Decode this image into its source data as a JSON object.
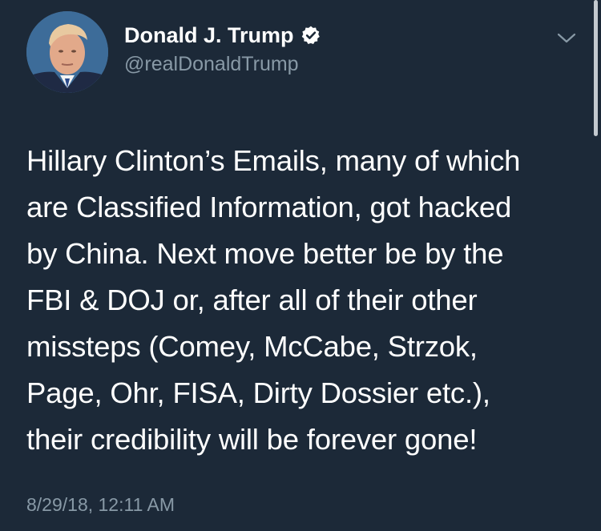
{
  "author": {
    "display_name": "Donald J. Trump",
    "handle": "@realDonaldTrump",
    "verified": true
  },
  "icons": {
    "verified": "verified-badge-icon",
    "menu": "chevron-down-icon"
  },
  "tweet": {
    "lines": [
      "Hillary Clinton’s Emails, many of which",
      "are Classified Information, got hacked",
      "by China. Next move better be by the",
      "FBI & DOJ or, after all of their other",
      "missteps (Comey, McCabe, Strzok,",
      "Page, Ohr, FISA, Dirty Dossier etc.),",
      "their credibility will be forever gone!"
    ],
    "timestamp": "8/29/18, 12:11 AM"
  },
  "colors": {
    "background": "#1c2938",
    "text": "#ffffff",
    "secondary": "#8899a6"
  }
}
